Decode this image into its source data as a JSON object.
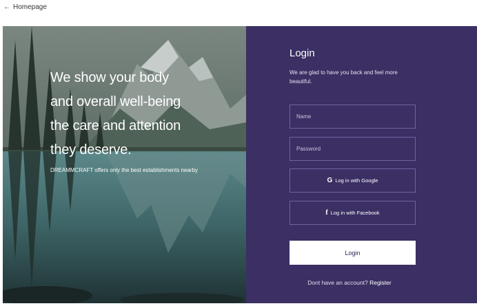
{
  "nav": {
    "back_label": "Homepage",
    "back_icon": "left-arrow-icon"
  },
  "hero": {
    "title": "We show your body and overall well-being  the care and attention they deserve.",
    "subtitle": "DREAMMCRAFT offers only  the best establishments nearby"
  },
  "login": {
    "title": "Login",
    "subtitle": "We are glad to have you back and feel more beautiful.",
    "name_placeholder": "Name",
    "password_placeholder": "Password",
    "google_label": "Log in with Google",
    "facebook_label": "Log in with Facebook",
    "submit_label": "Login",
    "register_prompt": "Dont have an account?",
    "register_link": "Register"
  },
  "colors": {
    "panel_bg": "#3b2f63",
    "button_bg": "#ffffff",
    "field_border": "#6e64a0"
  }
}
